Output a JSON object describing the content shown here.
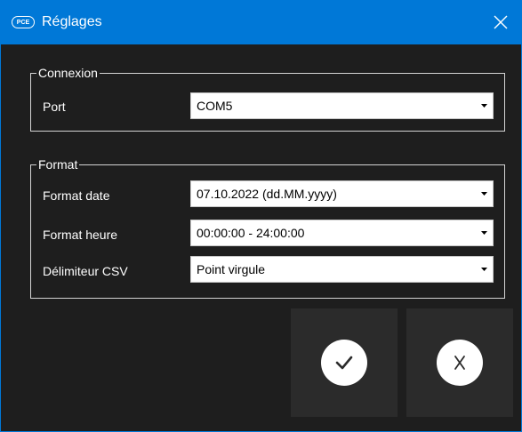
{
  "window": {
    "title": "Réglages",
    "logo_text": "PCE",
    "accent_color": "#0078d7",
    "background_color": "#1e1e1e"
  },
  "connection": {
    "group_label": "Connexion",
    "port_label": "Port",
    "port_value": "COM5"
  },
  "format": {
    "group_label": "Format",
    "date_label": "Format date",
    "date_value": "07.10.2022 (dd.MM.yyyy)",
    "time_label": "Format heure",
    "time_value": "00:00:00 - 24:00:00",
    "csv_label": "Délimiteur CSV",
    "csv_value": "Point virgule"
  },
  "icons": {
    "close": "close-icon",
    "confirm": "checkmark-icon",
    "cancel": "x-icon",
    "dropdown": "chevron-down-icon"
  }
}
